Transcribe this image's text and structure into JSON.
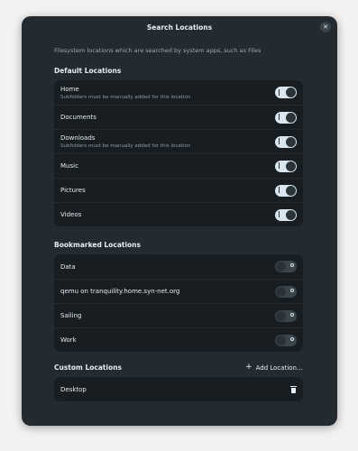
{
  "dialog": {
    "title": "Search Locations",
    "description": "Filesystem locations which are searched by system apps, such as Files"
  },
  "default_section": {
    "title": "Default Locations",
    "items": [
      {
        "label": "Home",
        "subtitle": "Subfolders must be manually added for this location",
        "enabled": true
      },
      {
        "label": "Documents",
        "subtitle": "",
        "enabled": true
      },
      {
        "label": "Downloads",
        "subtitle": "Subfolders must be manually added for this location",
        "enabled": true
      },
      {
        "label": "Music",
        "subtitle": "",
        "enabled": true
      },
      {
        "label": "Pictures",
        "subtitle": "",
        "enabled": true
      },
      {
        "label": "Videos",
        "subtitle": "",
        "enabled": true
      }
    ]
  },
  "bookmarked_section": {
    "title": "Bookmarked Locations",
    "items": [
      {
        "label": "Data",
        "enabled": false
      },
      {
        "label": "qemu on tranquility.home.syn-net.org",
        "enabled": false
      },
      {
        "label": "Sailing",
        "enabled": false
      },
      {
        "label": "Work",
        "enabled": false
      }
    ]
  },
  "custom_section": {
    "title": "Custom Locations",
    "add_label": "Add Location…",
    "items": [
      {
        "label": "Desktop"
      }
    ]
  },
  "icons": {
    "close": "close-icon",
    "add": "plus-icon",
    "delete": "trash-icon"
  }
}
